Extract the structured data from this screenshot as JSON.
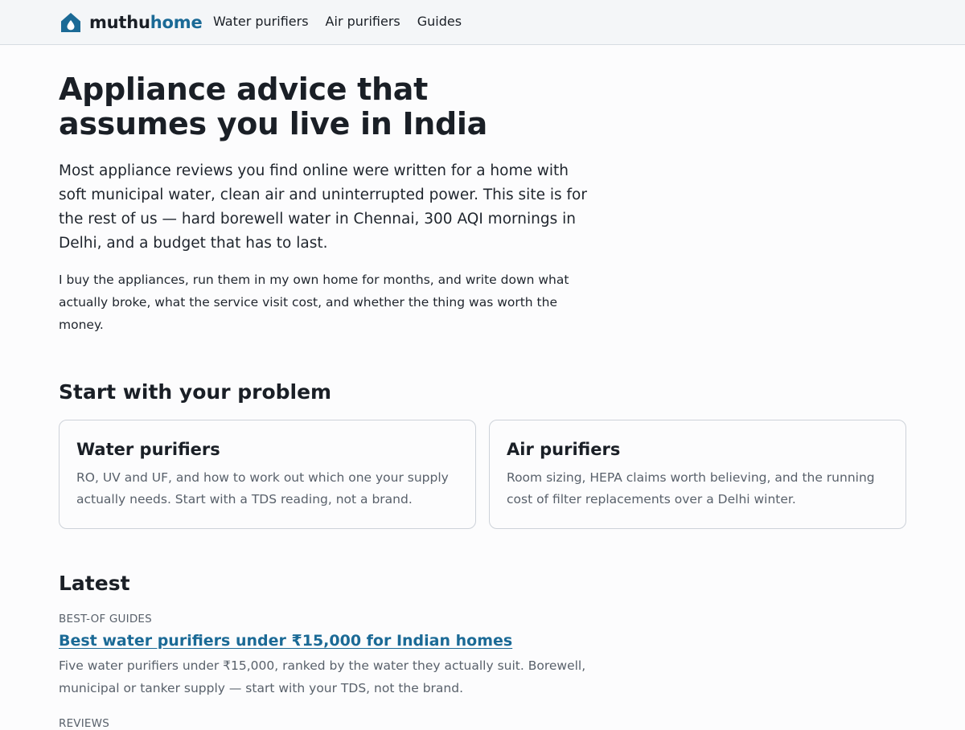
{
  "header": {
    "logo_part1": "muthu",
    "logo_part2": "home",
    "nav": [
      "Water purifiers",
      "Air purifiers",
      "Guides"
    ]
  },
  "hero": {
    "title_line1": "Appliance advice that",
    "title_line2": "assumes you live in India",
    "lede": "Most appliance reviews you find online were written for a home with soft municipal water, clean air and uninterrupted power. This site is for the rest of us — hard borewell water in Chennai, 300 AQI mornings in Delhi, and a budget that has to last.",
    "paragraph": "I buy the appliances, run them in my own home for months, and write down what actually broke, what the service visit cost, and whether the thing was worth the money."
  },
  "problems": {
    "heading": "Start with your problem",
    "cards": [
      {
        "title": "Water purifiers",
        "text": "RO, UV and UF, and how to work out which one your supply actually needs. Start with a TDS reading, not a brand."
      },
      {
        "title": "Air purifiers",
        "text": "Room sizing, HEPA claims worth believing, and the running cost of filter replacements over a Delhi winter."
      }
    ]
  },
  "latest": {
    "heading": "Latest",
    "posts": [
      {
        "category": "BEST-OF GUIDES",
        "title": "Best water purifiers under ₹15,000 for Indian homes",
        "description": "Five water purifiers under ₹15,000, ranked by the water they actually suit. Borewell, municipal or tanker supply — start with your TDS, not the brand."
      },
      {
        "category": "REVIEWS"
      }
    ]
  },
  "colors": {
    "brand": "#1b6a96",
    "text": "#1a1f26",
    "muted": "#59616b",
    "header_bg": "#f4f6f8"
  },
  "icons": {
    "logo": "house-with-droplet-icon"
  }
}
